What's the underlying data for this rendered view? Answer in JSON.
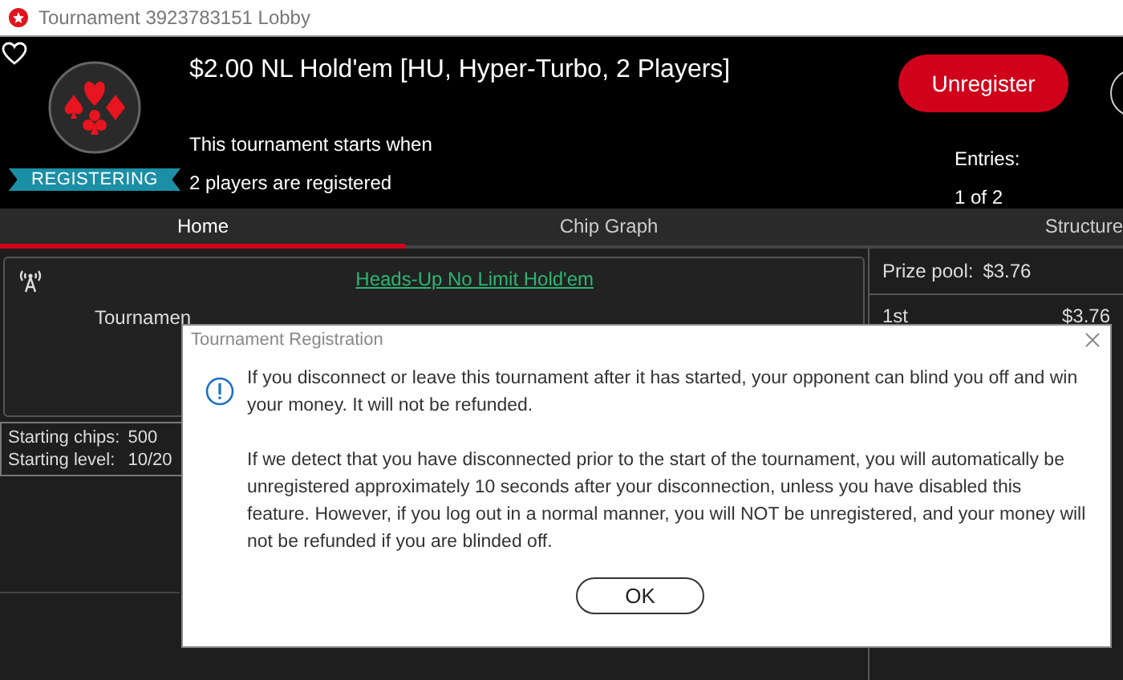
{
  "window": {
    "title": "Tournament 3923783151 Lobby"
  },
  "header": {
    "title": "$2.00 NL Hold'em [HU, Hyper-Turbo, 2 Players]",
    "status_badge": "REGISTERING",
    "start_note": [
      "This tournament starts when",
      "2 players are registered"
    ],
    "action_button": "Unregister",
    "entries_label": "Entries:",
    "entries_value": "1 of 2"
  },
  "tabs": [
    {
      "label": "Home",
      "selected": true
    },
    {
      "label": "Chip Graph",
      "selected": false
    },
    {
      "label": "Structure",
      "selected": false
    }
  ],
  "info": {
    "game_link": "Heads-Up No Limit Hold'em",
    "description": "Tournamen"
  },
  "stats": [
    {
      "label": "Starting chips:",
      "value": "500"
    },
    {
      "label": "Starting level:",
      "value": "10/20"
    }
  ],
  "prizes": {
    "pool_label": "Prize pool:",
    "pool_value": "$3.76",
    "places": [
      {
        "place": "1st",
        "amount": "$3.76"
      }
    ]
  },
  "dialog": {
    "title": "Tournament Registration",
    "paragraphs": [
      "If you disconnect or leave this tournament after it has started, your opponent can blind you off and win your money. It will not be refunded.",
      "If we detect that you have disconnected prior to the start of the tournament, you will automatically be unregistered approximately 10 seconds after your disconnection, unless you have disabled this feature. However, if you log out in a normal manner, you will NOT be unregistered, and your money will not be refunded if you are blinded off."
    ],
    "button": "OK"
  }
}
